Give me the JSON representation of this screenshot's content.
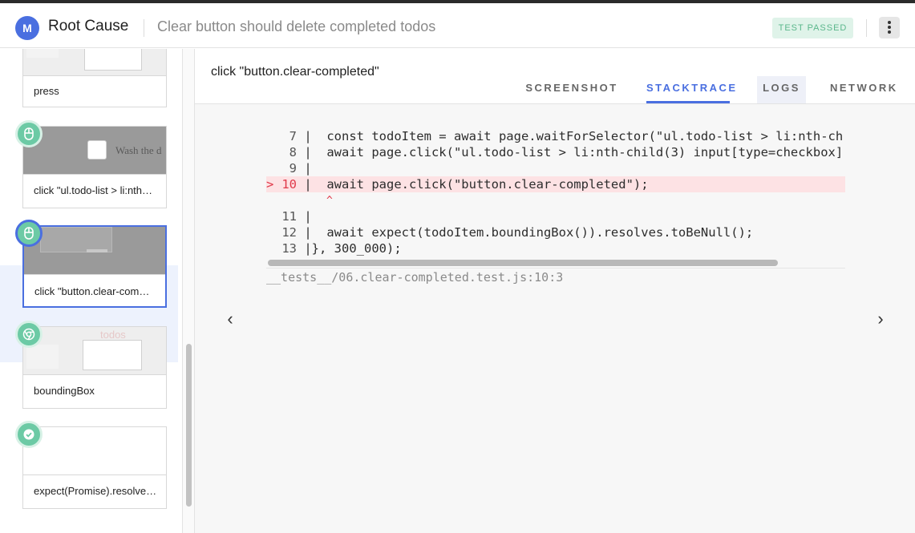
{
  "header": {
    "logo_letter": "M",
    "app_title": "Root Cause",
    "page_title": "Clear button should delete completed todos",
    "status_badge": "TEST PASSED"
  },
  "steps": [
    {
      "label": "press",
      "icon": "none"
    },
    {
      "label": "click \"ul.todo-list > li:nth…",
      "icon": "mouse-icon"
    },
    {
      "label": "click \"button.clear-com…",
      "icon": "mouse-icon",
      "selected": true
    },
    {
      "label": "boundingBox",
      "icon": "chrome-icon"
    },
    {
      "label": "expect(Promise).resolve…",
      "icon": "check-icon"
    }
  ],
  "thumb_text": {
    "wash": "Wash the d",
    "todos": "todos"
  },
  "main": {
    "step_title": "click \"button.clear-completed\"",
    "tabs": [
      "SCREENSHOT",
      "STACKTRACE",
      "LOGS",
      "NETWORK"
    ],
    "active_tab": "STACKTRACE",
    "code": [
      {
        "num": " 7",
        "text": " |  const todoItem = await page.waitForSelector(\"ul.todo-list > li:nth-ch"
      },
      {
        "num": " 8",
        "text": " |  await page.click(\"ul.todo-list > li:nth-child(3) input[type=checkbox]"
      },
      {
        "num": " 9",
        "text": " |"
      },
      {
        "num": "10",
        "text": " |  await page.click(\"button.clear-completed\");",
        "highlight": true
      },
      {
        "num": "11",
        "text": " |"
      },
      {
        "num": "12",
        "text": " |  await expect(todoItem.boundingBox()).resolves.toBeNull();"
      },
      {
        "num": "13",
        "text": " |}, 300_000);"
      }
    ],
    "error_marker": ">",
    "caret": "^",
    "location": "__tests__/06.clear-completed.test.js:10:3",
    "prev_arrow": "‹",
    "next_arrow": "›"
  },
  "colors": {
    "accent": "#4a6fe0",
    "passed_bg": "#dff3e9",
    "passed_text": "#5bb78c",
    "error_line_bg": "#fde2e4",
    "error_text": "#e0394a",
    "step_icon": "#6ccaa5"
  }
}
